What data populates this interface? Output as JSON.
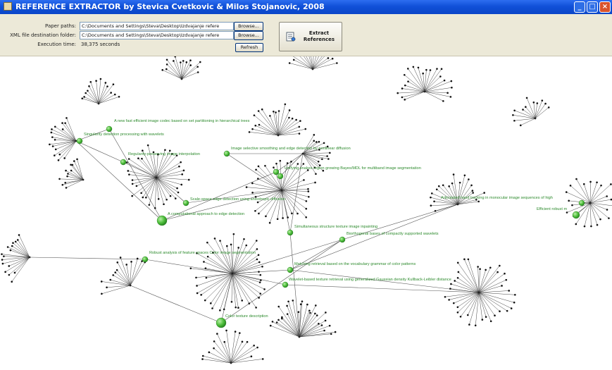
{
  "window": {
    "title": "REFERENCE EXTRACTOR by Stevica Cvetkovic & Milos Stojanovic, 2008"
  },
  "form": {
    "paper_paths_label": "Paper paths:",
    "paper_paths_value": "C:\\Documents and Settings\\Steva\\Desktop\\Izdvajanje refere",
    "xml_label": "XML file destination folder:",
    "xml_value": "C:\\Documents and Settings\\Steva\\Desktop\\Izdvajanje refere",
    "execution_label": "Execution time:",
    "execution_value": "38,375 seconds",
    "browse1": "Browse...",
    "browse2": "Browse...",
    "refresh": "Refresh",
    "extract_line1": "Extract",
    "extract_line2": "References"
  },
  "graph": {
    "labels": [
      "A new fast  efficient image codec based on set partitioning in hierarchical trees",
      "Singularity detection  processing with wavelets",
      "Regularity-preserving  image  interpolation",
      "Image selective smoothing and edge detection by nonlinear diffusion",
      "Unifying snakes  region growing   Bayes/MDL for multiband image segmentation",
      "Scale-space  edge detection using anisotropic diffusion",
      "A computational approach to edge detection",
      "Simultaneous structure  texture image inpainting",
      "Biorthogonal bases of compactly supported wavelets",
      "Robust analysis of feature spaces  Color image segmentation",
      "Matching  retrieval based on the vocabulary  grammar of color patterns",
      "Wavelet-based texture retrieval using  generalized Gaussian density  Kullback-Leibler distance",
      "Color texture description",
      "Articulated  hand tracking in monocular image sequences of high",
      "Efficient  robust m"
    ]
  }
}
